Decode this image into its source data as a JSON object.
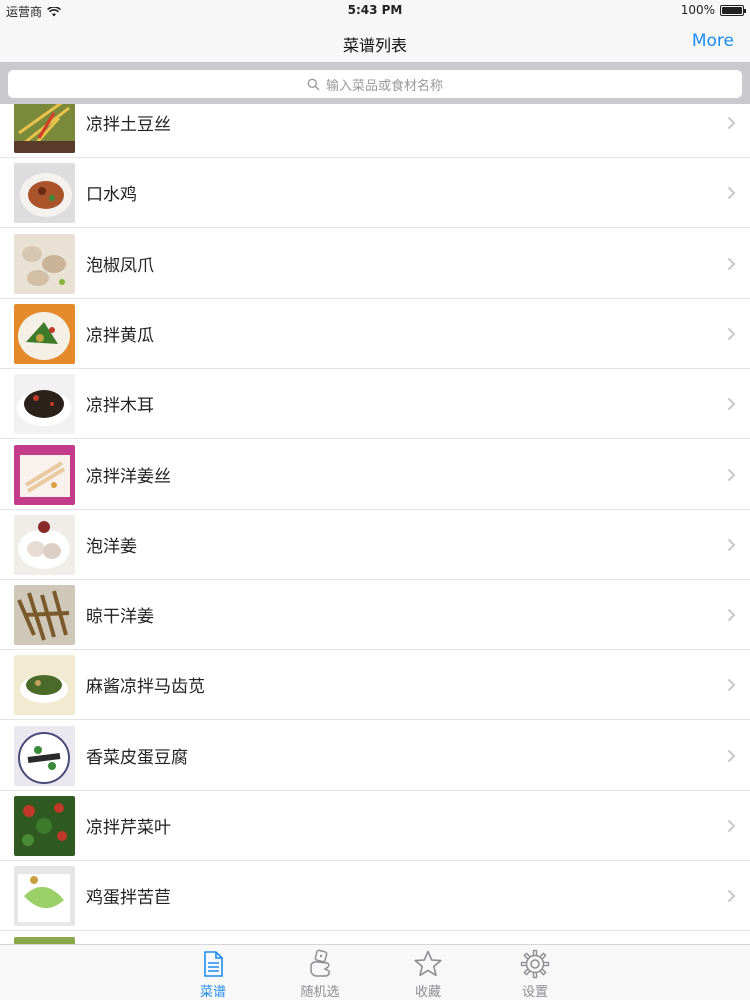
{
  "status_bar": {
    "carrier": "运营商",
    "time": "5:43 PM",
    "battery_text": "100%",
    "battery_level": 1.0
  },
  "nav": {
    "title": "菜谱列表",
    "more_label": "More"
  },
  "search": {
    "placeholder": "输入菜品或食材名称"
  },
  "recipes": [
    {
      "name": "凉拌土豆丝"
    },
    {
      "name": "口水鸡"
    },
    {
      "name": "泡椒凤爪"
    },
    {
      "name": "凉拌黄瓜"
    },
    {
      "name": "凉拌木耳"
    },
    {
      "name": "凉拌洋姜丝"
    },
    {
      "name": "泡洋姜"
    },
    {
      "name": "晾干洋姜"
    },
    {
      "name": "麻酱凉拌马齿苋"
    },
    {
      "name": "香菜皮蛋豆腐"
    },
    {
      "name": "凉拌芹菜叶"
    },
    {
      "name": "鸡蛋拌苦苣"
    }
  ],
  "tabs": [
    {
      "label": "菜谱",
      "icon": "document-icon",
      "active": true
    },
    {
      "label": "随机选",
      "icon": "dice-hand-icon",
      "active": false
    },
    {
      "label": "收藏",
      "icon": "star-icon",
      "active": false
    },
    {
      "label": "设置",
      "icon": "gear-icon",
      "active": false
    }
  ],
  "colors": {
    "accent": "#1d8cf0",
    "inactive": "#8e8e93",
    "search_bg": "#c9c9ce"
  }
}
